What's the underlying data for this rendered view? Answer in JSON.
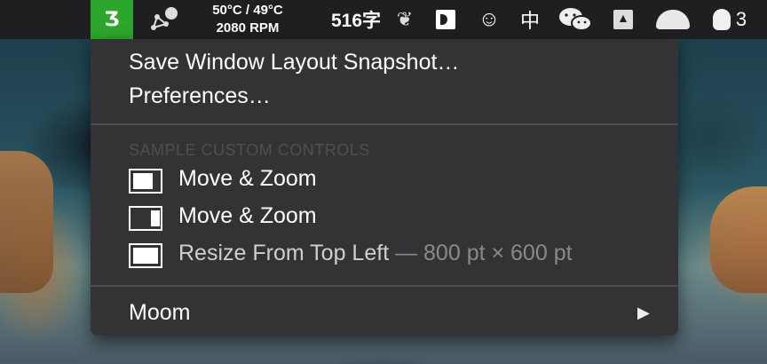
{
  "menubar": {
    "temperature": "50°C / 49°C",
    "fan": "2080 RPM",
    "word_count": "516字",
    "input_method": "中",
    "qq_count": "3",
    "icons": [
      "moom-icon",
      "network-icon",
      "leaf-icon",
      "clip-icon",
      "smile-icon",
      "input-method-icon",
      "wechat-icon",
      "drive-icon",
      "helmet-icon",
      "qq-icon"
    ]
  },
  "menu": {
    "save_snapshot": "Save Window Layout Snapshot…",
    "preferences": "Preferences…",
    "section_header": "SAMPLE CUSTOM CONTROLS",
    "controls": [
      {
        "label": "Move & Zoom",
        "suffix": ""
      },
      {
        "label": "Move & Zoom",
        "suffix": ""
      },
      {
        "label": "Resize From Top Left",
        "suffix": " — 800 pt × 600 pt"
      }
    ],
    "moom": "Moom"
  },
  "colors": {
    "menubar_bg": "#1f1f21",
    "menu_bg": "#333335",
    "moom_accent": "#2da62d"
  }
}
